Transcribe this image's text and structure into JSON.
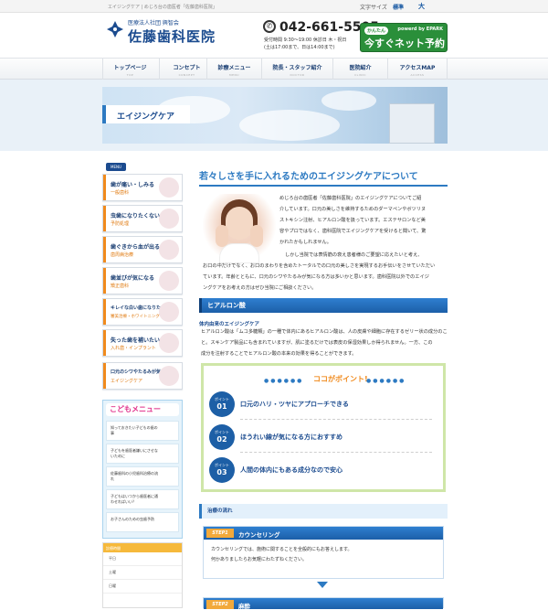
{
  "topbar": {
    "tagline": "エイジングケア | めじろ台の歯医者「佐藤歯科医院」",
    "font_size_label": "文字サイズ",
    "font_standard": "標準",
    "font_large": "大"
  },
  "header": {
    "logo_sub": "医療法人社団 興智会",
    "logo_main": "佐藤歯科医院",
    "tel": "042-661-5505",
    "hours1": "受付時間 9:30〜19:00 休診日 木・祝日",
    "hours2": "(土は17:00まで、日は14:00まで)",
    "net_kantan": "かんたん",
    "net_epark": "powerd by EPARK",
    "net_main": "今すぐネット予約"
  },
  "nav": [
    {
      "jp": "トップページ",
      "en": "TOP"
    },
    {
      "jp": "コンセプト",
      "en": "CONCEPT"
    },
    {
      "jp": "診療メニュー",
      "en": "MENU"
    },
    {
      "jp": "院長・スタッフ紹介",
      "en": "DOCTOR"
    },
    {
      "jp": "医院紹介",
      "en": "CLINIC"
    },
    {
      "jp": "アクセスMAP",
      "en": "ACCESS"
    }
  ],
  "hero": {
    "title": "エイジングケア"
  },
  "sidebar": {
    "menu_caption": "MENU",
    "items": [
      {
        "t1": "歯が痛い・しみる",
        "t2": "一般歯科"
      },
      {
        "t1": "虫歯になりたくない",
        "t2": "予防処理"
      },
      {
        "t1": "歯ぐきから血が出る",
        "t2": "歯周病治療"
      },
      {
        "t1": "歯並びが気になる",
        "t2": "矯正歯科"
      },
      {
        "t1": "キレイな白い歯になりたい",
        "t2": "審美治療・ホワイトニング"
      },
      {
        "t1": "失った歯を補いたい",
        "t2": "入れ歯・インプラント"
      },
      {
        "t1": "口元のシワやたるみが気になる",
        "t2": "エイジングケア"
      }
    ],
    "kids_title": "こどもメニュー",
    "kids_items": [
      "知っておきたい子どもの歯の事",
      "子どもを歯医者嫌いにさせないために",
      "佐藤歯科の小児歯科治療の流れ",
      "子どもはいつから歯医者に通わせればいい？",
      "お子さんのための虫歯予防"
    ],
    "hours_head": "診療時間",
    "hours_rows": [
      "平日",
      "土曜",
      "日曜"
    ]
  },
  "main": {
    "title": "若々しさを手に入れるためのエイジングケアについて",
    "intro1": "めじろ台の歯医者「佐藤歯科医院」のエイジングケアについてご紹",
    "intro2": "介しています。口元の美しさを維持するためのダーマペンやボツリヌ",
    "intro3": "ストキシン注射、ヒアルロン酸を扱っています。エステサロンなど美",
    "intro4": "容やプロではなく、歯科医院でエイジングケアを受けると聞いて、驚",
    "intro5": "かれたかもしれません。",
    "para2_1": "しかし当院では表情筋の衰え患者様のご要望に応えたいと考え、",
    "para2_2": "お口の中だけでなく、お口のまわりを含めたトータルでの口元の美しさを実現するお手伝いをさせていただい",
    "para2_3": "ています。年齢とともに、口元のシワやたるみが気になる方は多いかと思います。歯科医院以外でのエイジ",
    "para2_4": "ングケアをお考えの方はぜひ当院にご相談ください。",
    "section1": "ヒアルロン酸",
    "sub1": "体内由来のエイジングケア",
    "s1_1": "ヒアルロン酸は「ムコ多糖類」の一種で体内にあるヒアルロン酸は、人の皮膚や細胞に存在するゼリー状の成分のこ",
    "s1_2": "と。スキンケア製品にも含まれていますが、肌に塗るだけでは表皮の保湿効果しか得られません。一方、この",
    "s1_3": "成分を注射することでヒアルロン酸の本来の効果を得ることができます。",
    "points_title": "ココがポイント!",
    "point_label": "ポイント",
    "points": [
      {
        "num": "01",
        "text": "口元のハリ・ツヤにアプローチできる"
      },
      {
        "num": "02",
        "text": "ほうれい線が気になる方におすすめ"
      },
      {
        "num": "03",
        "text": "人間の体内にもある成分なので安心"
      }
    ],
    "flow_title": "治療の流れ",
    "steps": [
      {
        "tag": "STEP1",
        "title": "カウンセリング",
        "l1": "カウンセリングでは、施術に関することを全般的にもお答えします。",
        "l2": "何かありましたらお気軽にわたずねください。"
      },
      {
        "tag": "STEP2",
        "title": "麻酔",
        "l1": "",
        "l2": ""
      }
    ]
  }
}
